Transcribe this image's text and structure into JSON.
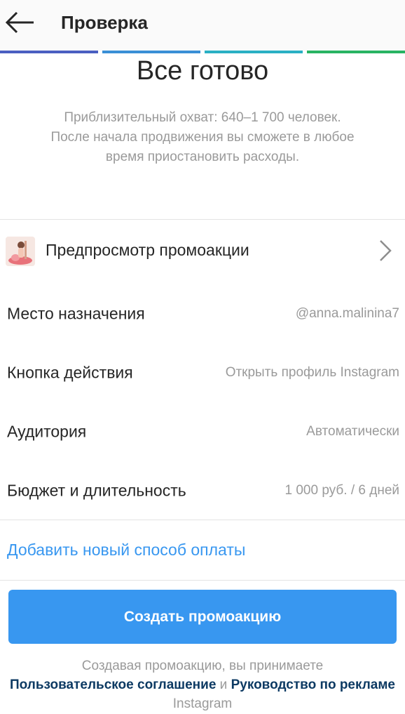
{
  "header": {
    "title": "Проверка",
    "back_icon": "arrow-left-icon",
    "progress_colors": [
      "#4a5fc1",
      "#3a8fd6",
      "#2ab0c4",
      "#28b463"
    ]
  },
  "summary": {
    "title": "Все готово",
    "reach_line1": "Приблизительный охват: 640–1 700 человек.",
    "reach_line2": "После начала продвижения вы сможете в любое",
    "reach_line3": "время приостановить расходы."
  },
  "details": {
    "preview_label": "Предпросмотр промоакции",
    "preview_icon": "chevron-right-icon",
    "rows": [
      {
        "label": "Место назначения",
        "value": "@anna.malinina7"
      },
      {
        "label": "Кнопка действия",
        "value": "Открыть профиль Instagram"
      },
      {
        "label": "Аудитория",
        "value": "Автоматически"
      },
      {
        "label": "Бюджет и длительность",
        "value": "1 000 руб. / 6 дней"
      }
    ]
  },
  "payment": {
    "add_label": "Добавить новый способ оплаты"
  },
  "actions": {
    "create_label": "Создать промоакцию"
  },
  "terms": {
    "prefix": "Создавая промоакцию, вы принимаете",
    "link1": "Пользовательское соглашение",
    "and": "и",
    "link2": "Руководство по рекламе",
    "suffix": "Instagram"
  },
  "colors": {
    "accent": "#3897f0",
    "link_dark": "#0d3a63"
  }
}
